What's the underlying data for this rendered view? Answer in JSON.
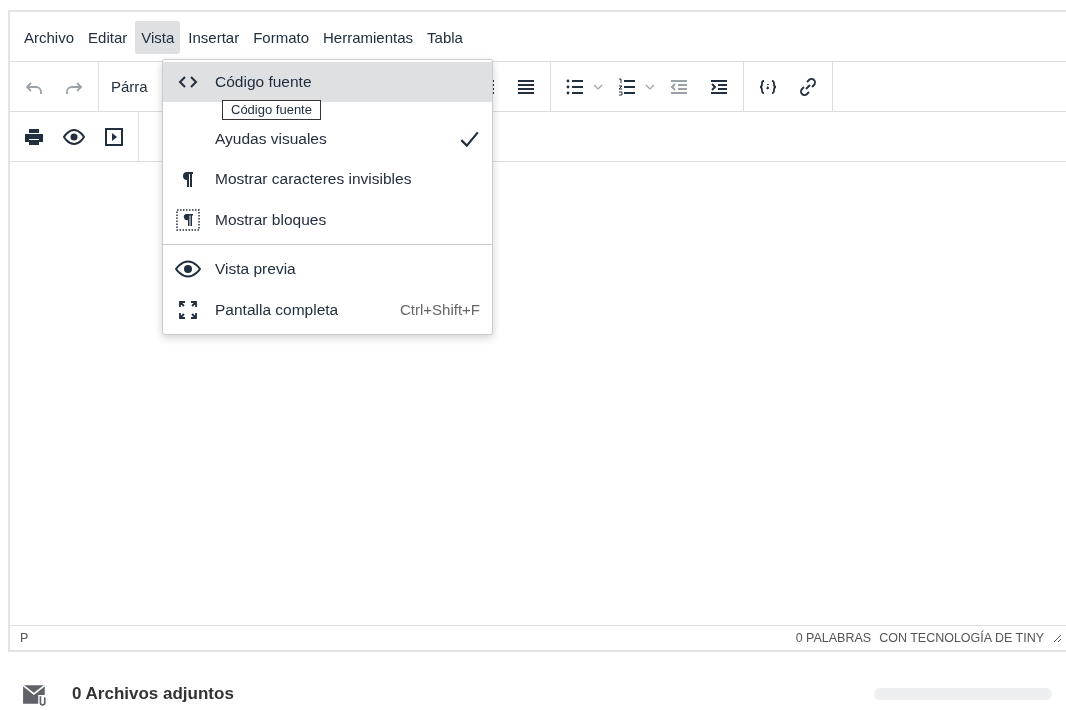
{
  "menubar": [
    {
      "label": "Archivo",
      "selected": false
    },
    {
      "label": "Editar",
      "selected": false
    },
    {
      "label": "Vista",
      "selected": true
    },
    {
      "label": "Insertar",
      "selected": false
    },
    {
      "label": "Formato",
      "selected": false
    },
    {
      "label": "Herramientas",
      "selected": false
    },
    {
      "label": "Tabla",
      "selected": false
    }
  ],
  "toolbar": {
    "block_format": "Párra"
  },
  "view_menu": {
    "sections": [
      [
        {
          "label": "Código fuente",
          "selected": true,
          "checked": false
        },
        {
          "label": "Ayudas visuales",
          "selected": false,
          "checked": true
        },
        {
          "label": "Mostrar caracteres invisibles",
          "selected": false,
          "checked": false
        },
        {
          "label": "Mostrar bloques",
          "selected": false,
          "checked": false
        }
      ],
      [
        {
          "label": "Vista previa",
          "selected": false,
          "checked": false
        },
        {
          "label": "Pantalla completa",
          "selected": false,
          "checked": false,
          "shortcut": "Ctrl+Shift+F"
        }
      ]
    ]
  },
  "tooltip": "Código fuente",
  "status_bar": {
    "path": "P",
    "word_count": "0 PALABRAS",
    "branding": "CON TECNOLOGÍA DE TINY"
  },
  "attachments": {
    "label": "0 Archivos adjuntos"
  }
}
